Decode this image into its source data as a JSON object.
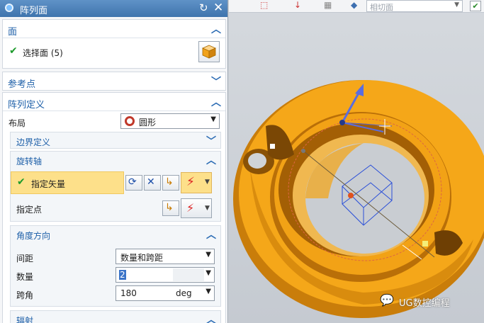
{
  "dialog": {
    "title": "阵列面",
    "reset_icon": "↻",
    "close_icon": "✕"
  },
  "face_section": {
    "title": "面",
    "select_label": "选择面 (5)"
  },
  "reference_section": {
    "title": "参考点"
  },
  "array_section": {
    "title": "阵列定义",
    "layout_label": "布局",
    "layout_value": "圆形",
    "boundary_title": "边界定义",
    "rotation_axis_title": "旋转轴",
    "specify_vector_label": "指定矢量",
    "specify_point_label": "指定点",
    "angle_title": "角度方向",
    "spacing_label": "间距",
    "spacing_value": "数量和跨距",
    "count_label": "数量",
    "count_value": "2",
    "span_label": "跨角",
    "span_value": "180",
    "span_unit": "deg",
    "radiate_title": "辐射"
  },
  "viewport": {
    "filter_value": "相切面",
    "watermark": "UG数控编程"
  },
  "colors": {
    "title_bar": "#4a7fb8",
    "section_header_text": "#1d5fa8",
    "highlight_row": "#fde08a",
    "part_color": "#f5a719",
    "check_green": "#1c9a2a"
  }
}
